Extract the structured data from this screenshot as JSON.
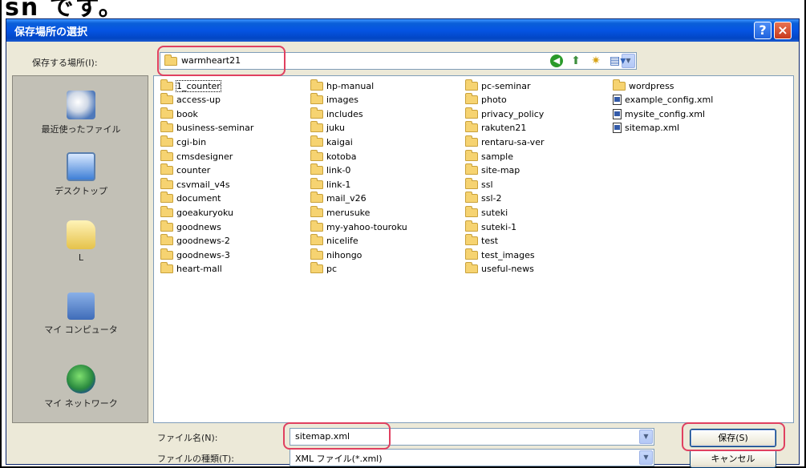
{
  "page_top_text": "sn です。",
  "dialog": {
    "title": "保存場所の選択",
    "help_glyph": "?",
    "close_glyph": "×"
  },
  "save_in": {
    "label": "保存する場所(I):",
    "value": "warmheart21"
  },
  "places": [
    {
      "label": "最近使ったファイル",
      "icon": "recent-files-icon"
    },
    {
      "label": "デスクトップ",
      "icon": "desktop-icon"
    },
    {
      "label": "L",
      "icon": "my-documents-icon"
    },
    {
      "label": "マイ コンピュータ",
      "icon": "my-computer-icon"
    },
    {
      "label": "マイ ネットワーク",
      "icon": "my-network-icon"
    }
  ],
  "files": {
    "col1": [
      "1_counter",
      "access-up",
      "book",
      "business-seminar",
      "cgi-bin",
      "cmsdesigner",
      "counter",
      "csvmail_v4s",
      "document",
      "goeakuryoku",
      "goodnews",
      "goodnews-2",
      "goodnews-3",
      "heart-mall"
    ],
    "col2": [
      "hp-manual",
      "images",
      "includes",
      "juku",
      "kaigai",
      "kotoba",
      "link-0",
      "link-1",
      "mail_v26",
      "merusuke",
      "my-yahoo-touroku",
      "nicelife",
      "nihongo",
      "pc"
    ],
    "col3": [
      "pc-seminar",
      "photo",
      "privacy_policy",
      "rakuten21",
      "rentaru-sa-ver",
      "sample",
      "site-map",
      "ssl",
      "ssl-2",
      "suteki",
      "suteki-1",
      "test",
      "test_images",
      "useful-news"
    ],
    "col4_folders": [
      "wordpress"
    ],
    "col4_files": [
      "example_config.xml",
      "mysite_config.xml",
      "sitemap.xml"
    ]
  },
  "file_name": {
    "label": "ファイル名(N):",
    "value": "sitemap.xml"
  },
  "file_type": {
    "label": "ファイルの種類(T):",
    "value": "XML ファイル(*.xml)"
  },
  "buttons": {
    "save": "保存(S)",
    "cancel": "キャンセル"
  },
  "glyphs": {
    "dropdown": "▼",
    "back": "◀",
    "up": "⬆",
    "new_folder": "✷",
    "views": "▤▾"
  },
  "colors": {
    "highlight": "#e04060",
    "titlebar": "#0554e3"
  }
}
